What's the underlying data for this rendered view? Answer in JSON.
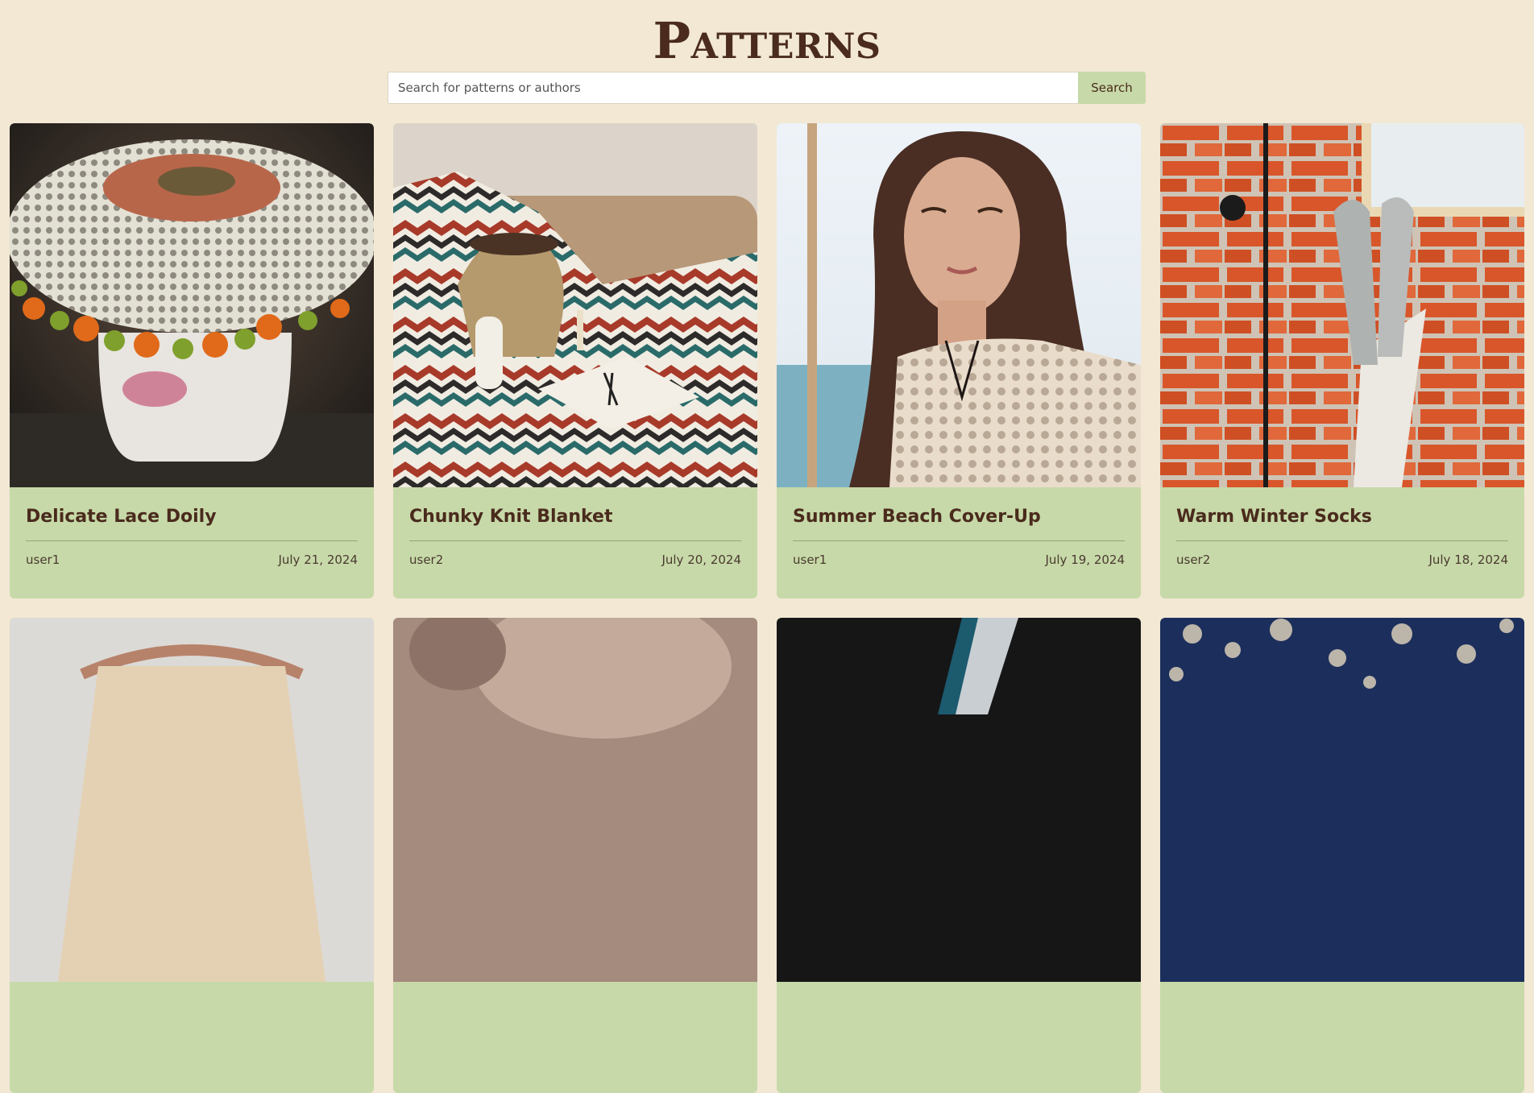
{
  "header": {
    "title": "Patterns"
  },
  "search": {
    "placeholder": "Search for patterns or authors",
    "value": "",
    "button_label": "Search"
  },
  "patterns": [
    {
      "title": "Delicate Lace Doily",
      "author": "user1",
      "date": "July 21, 2024",
      "image": "lace-doily-photo"
    },
    {
      "title": "Chunky Knit Blanket",
      "author": "user2",
      "date": "July 20, 2024",
      "image": "chevron-blanket-photo"
    },
    {
      "title": "Summer Beach Cover-Up",
      "author": "user1",
      "date": "July 19, 2024",
      "image": "beach-coverup-photo"
    },
    {
      "title": "Warm Winter Socks",
      "author": "user2",
      "date": "July 18, 2024",
      "image": "winter-socks-photo"
    },
    {
      "image": "hanger-top-photo"
    },
    {
      "image": "fluffy-yarn-photo"
    },
    {
      "image": "black-knit-ribbon-photo"
    },
    {
      "image": "blue-embroidery-photo"
    }
  ]
}
